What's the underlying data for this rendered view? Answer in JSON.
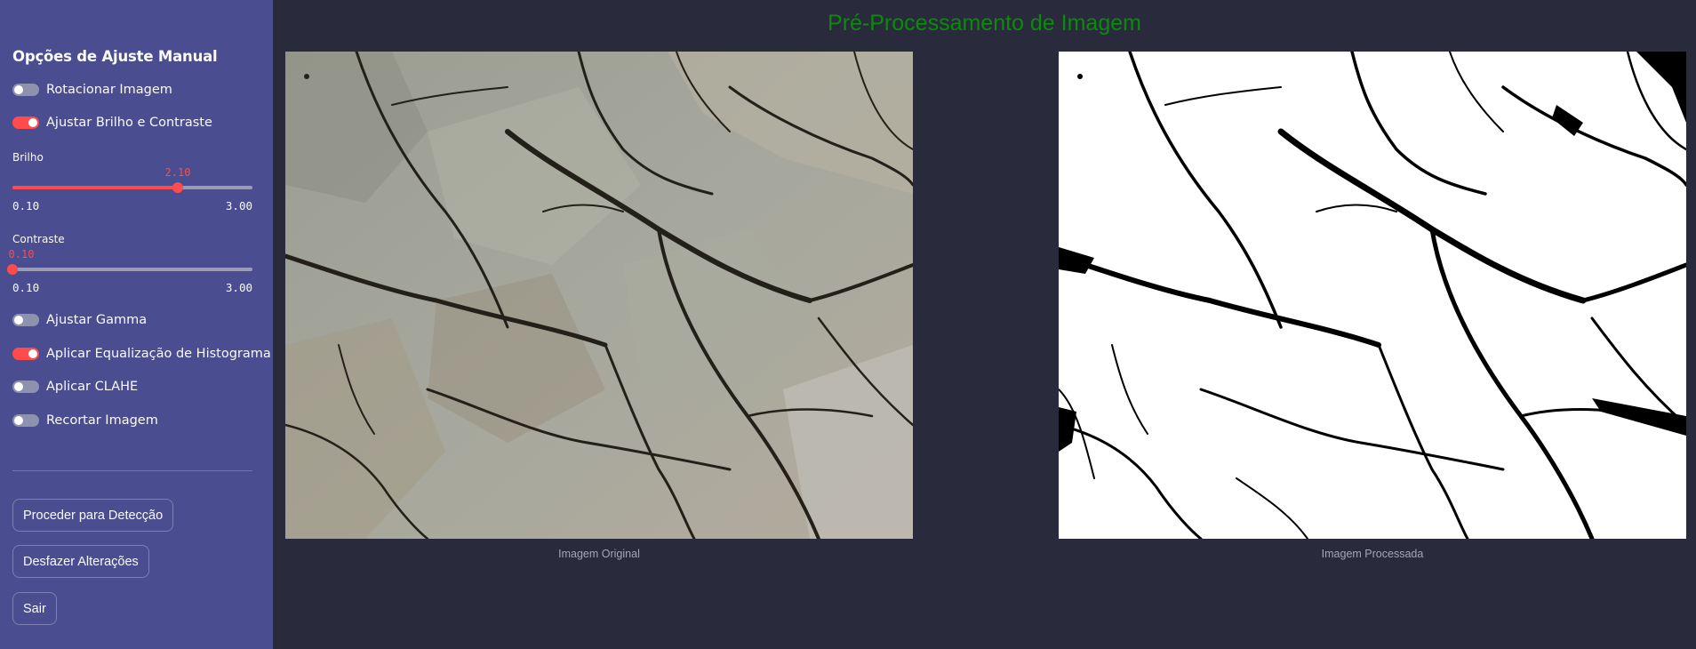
{
  "sidebar": {
    "title": "Opções de Ajuste Manual",
    "toggles": {
      "rotate": {
        "label": "Rotacionar Imagem",
        "on": false
      },
      "brightness_contrast": {
        "label": "Ajustar Brilho e Contraste",
        "on": true
      },
      "gamma": {
        "label": "Ajustar Gamma",
        "on": false
      },
      "hist_eq": {
        "label": "Aplicar Equalização de Histograma",
        "on": true
      },
      "clahe": {
        "label": "Aplicar CLAHE",
        "on": false
      },
      "crop": {
        "label": "Recortar Imagem",
        "on": false
      }
    },
    "brightness": {
      "label": "Brilho",
      "value": "2.10",
      "min": "0.10",
      "max": "3.00"
    },
    "contrast": {
      "label": "Contraste",
      "value": "0.10",
      "min": "0.10",
      "max": "3.00"
    },
    "buttons": {
      "detect": "Proceder para Detecção",
      "undo": "Desfazer Alterações",
      "exit": "Sair"
    },
    "accent_color": "#ff4b4b"
  },
  "main": {
    "title": "Pré-Processamento de Imagem",
    "title_color": "#0b8a0b",
    "images": {
      "original_caption": "Imagem Original",
      "processed_caption": "Imagem Processada"
    }
  }
}
